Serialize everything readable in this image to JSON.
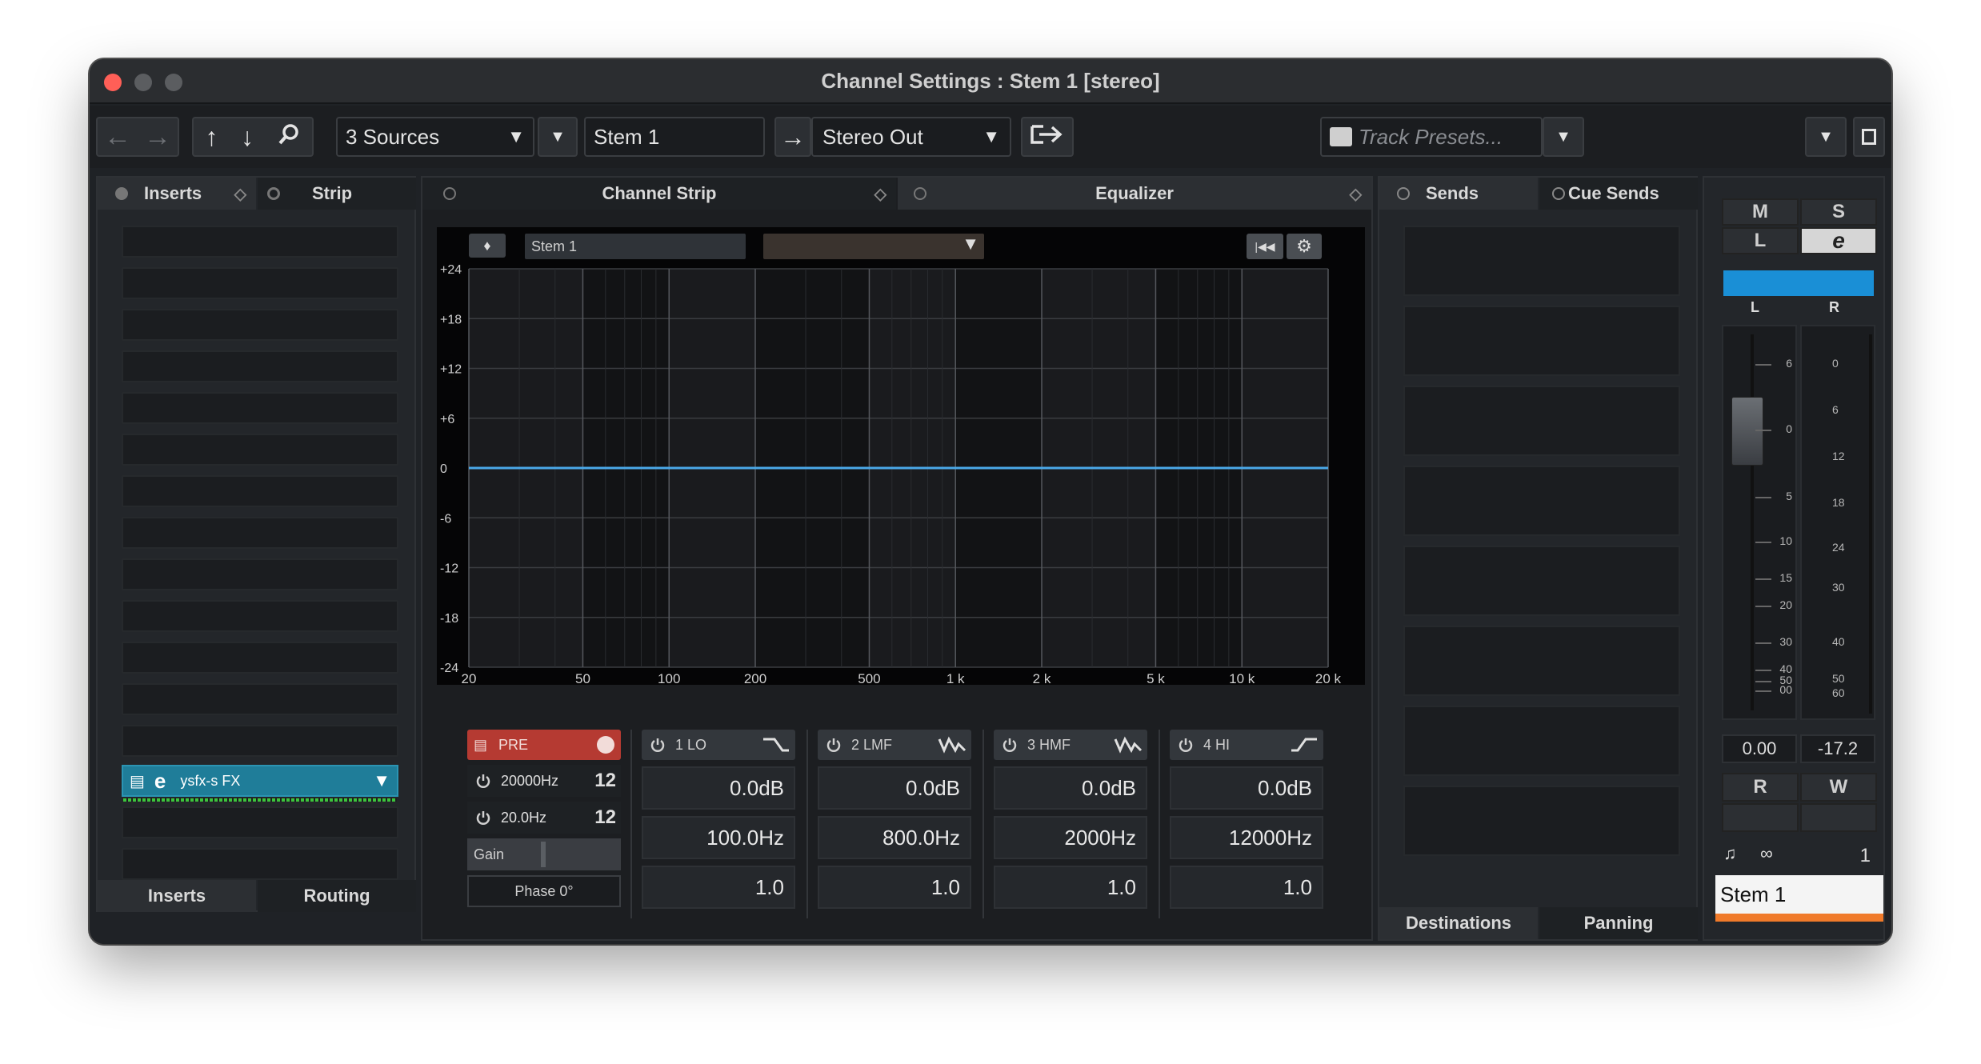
{
  "window": {
    "title": "Channel Settings : Stem 1 [stereo]"
  },
  "toolbar": {
    "sources": "3 Sources",
    "channel_name": "Stem 1",
    "output": "Stereo Out",
    "track_presets_placeholder": "Track Presets..."
  },
  "left_panel": {
    "tabs": [
      "Inserts",
      "Strip"
    ],
    "insert_plugin": "ysfx-s FX",
    "bottom_tabs": [
      "Inserts",
      "Routing"
    ]
  },
  "center_panel": {
    "tabs": [
      "Channel Strip",
      "Equalizer"
    ],
    "eq_channel_label": "Stem 1",
    "y_ticks": [
      "+24",
      "+18",
      "+12",
      "+6",
      "0",
      "-6",
      "-12",
      "-18",
      "-24"
    ],
    "x_ticks": [
      "20",
      "50",
      "100",
      "200",
      "500",
      "1 k",
      "2 k",
      "5 k",
      "10 k",
      "20 k"
    ]
  },
  "pre_section": {
    "label": "PRE",
    "hp_freq": "20000Hz",
    "hp_slope": "12",
    "lp_freq": "20.0Hz",
    "lp_slope": "12",
    "gain_label": "Gain",
    "phase_label": "Phase 0°"
  },
  "bands": [
    {
      "name": "1 LO",
      "gain": "0.0dB",
      "freq": "100.0Hz",
      "q": "1.0",
      "shape_icon": "low-shelf-icon"
    },
    {
      "name": "2 LMF",
      "gain": "0.0dB",
      "freq": "800.0Hz",
      "q": "1.0",
      "shape_icon": "peak-icon"
    },
    {
      "name": "3 HMF",
      "gain": "0.0dB",
      "freq": "2000Hz",
      "q": "1.0",
      "shape_icon": "peak-icon"
    },
    {
      "name": "4 HI",
      "gain": "0.0dB",
      "freq": "12000Hz",
      "q": "1.0",
      "shape_icon": "high-shelf-icon"
    }
  ],
  "sends_panel": {
    "tabs": [
      "Sends",
      "Cue Sends"
    ],
    "bottom_tabs": [
      "Destinations",
      "Panning"
    ]
  },
  "fader_panel": {
    "mute": "M",
    "solo": "S",
    "listen": "L",
    "pan_left": "L",
    "pan_right": "R",
    "fader_scale": [
      "6",
      "0",
      "5",
      "10",
      "15",
      "20",
      "30",
      "40",
      "50",
      "00"
    ],
    "meter_scale": [
      "0",
      "6",
      "12",
      "18",
      "24",
      "30",
      "40",
      "50",
      "60"
    ],
    "volume": "0.00",
    "peak": "-17.2",
    "read": "R",
    "write": "W",
    "channel_number": "1",
    "channel_name": "Stem 1"
  },
  "colors": {
    "accent_blue": "#1a8fd6",
    "eq_curve": "#4aa8e8",
    "pre_red": "#b53a32",
    "insert_teal": "#1f7d99",
    "name_orange": "#f07a2a"
  }
}
